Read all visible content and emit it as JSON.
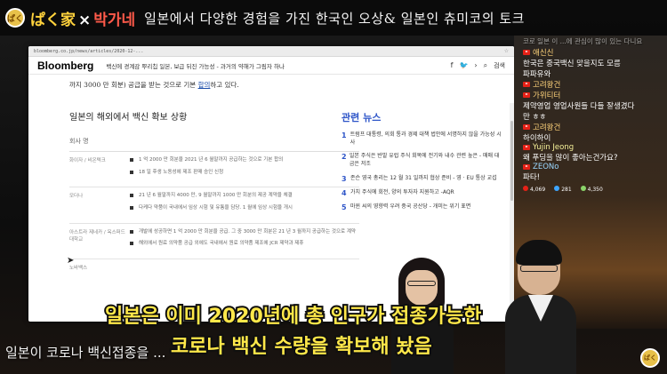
{
  "banner": {
    "channel_name_jp": "ぱく家",
    "channel_sep": "×",
    "channel_name_kr": "박가네",
    "tagline": "일본에서 다양한 경험을 가진 한국인 오상& 일본인 츄미코의 토크"
  },
  "browser": {
    "url": "bloomberg.co.jp/news/articles/2020-12-...",
    "site_logo": "Bloomberg",
    "header_headline": "백신에 경계감 뿌리칩 일본, 보급 뒤진 가능성 - 과거의 약해가 그림자 하나",
    "search_label": "검색"
  },
  "article": {
    "intro_prefix": "까지 3000 만 회분) 공급을 받는 것으로 기본",
    "intro_link": "합의",
    "intro_suffix": "하고 있다.",
    "section_title": "일본의 해외에서 백신 확보 상황",
    "company_header": "회사 명",
    "rows": [
      {
        "company": "화이자 / 비온텍크",
        "lines": [
          "1 억 2000 만 회분을 2021 년 6 월말까지 공급하는 것으로 기본 합의",
          "18 일 후생 노동성에 제조 판매 승인 신청"
        ]
      },
      {
        "company": "모더나",
        "lines": [
          "21 년 6 월말까지 4000 만, 9 월말까지 1000 만 회분의 제공 계약을 체결",
          "다케다 약품이 국내에서 임상 시험 및 유통을 담당. 1 월에 임상 시험을 개시"
        ]
      },
      {
        "company": "아스트라 제네카 / 옥스퍼드 대학교",
        "lines": [
          "개발에 성공하면 1 억 2000 만 회분을 공급. 그 중 3000 만 회분은 21 년 3 월까지 공급하는 것으로 계약",
          "해외에서 원료 의약품 공급 외에도 국내에서 원료 의약품 제조에 JCR 제약과 제휴"
        ]
      }
    ],
    "partial_row_company": "노바백스"
  },
  "related": {
    "title": "관련 뉴스",
    "items": [
      {
        "num": "1",
        "text": "트럼프 대통령, 의회 통과 경제 대책 법안에 서명하지 않을 가능성 시사"
      },
      {
        "num": "2",
        "text": "일본 주식은 반발 유럽 주식 회복에 전기와 내수 관련 높은 - 매매 대금은 저조"
      },
      {
        "num": "3",
        "text": "존슨 영국 총리는 12 월 31 일까지 협상 준비 - 영 · EU 통상 교섭"
      },
      {
        "num": "4",
        "text": "가치 주식에 회전, 양의 투자자 지원하고 -AQR"
      },
      {
        "num": "5",
        "text": "마윈 씨의 영향력 우려 중국 공산당 - 개미는 위기 표면"
      }
    ]
  },
  "chat": {
    "top_partial": "코로 일본 이 ...에 관심이 많이 있는 다니요",
    "messages": [
      {
        "user": "애신신",
        "text": "한국은 중국백신 맞을지도 모름",
        "user_color": "orange"
      },
      {
        "user": "",
        "text": "파파유와",
        "user_color": ""
      },
      {
        "user": "고려왕건",
        "text": "",
        "user_color": "orange"
      },
      {
        "user": "가위티터",
        "text": "제약영업 영업사원들 다들 잘생겼다",
        "user_color": "orange"
      },
      {
        "user": "",
        "text": "만 ㅎㅎ",
        "user_color": ""
      },
      {
        "user": "고려왕건",
        "text": "하이하이",
        "user_color": "orange"
      },
      {
        "user": "Yujin Jeong",
        "text": "왜 푸딩을 많이 좋아는건가요?",
        "user_color": "yellow"
      },
      {
        "user": "ZEONo",
        "text": "파타!",
        "user_color": "blue"
      }
    ],
    "stats": {
      "views": "4,069",
      "likes": "281",
      "viewers": "4,350"
    }
  },
  "subtitles": {
    "line1": "일본은 이미 2020년에 총 인구가 접종가능한",
    "line2": "코로나 백신 수량을 확보해 놨음",
    "bottom_caption": "일본이 코로나 백신접종을 ..."
  },
  "colors": {
    "subtitle_fill": "#ffe84a",
    "related_blue": "#2e55c8",
    "channel_yellow": "#ffd23c",
    "channel_red": "#ff5a4a"
  }
}
